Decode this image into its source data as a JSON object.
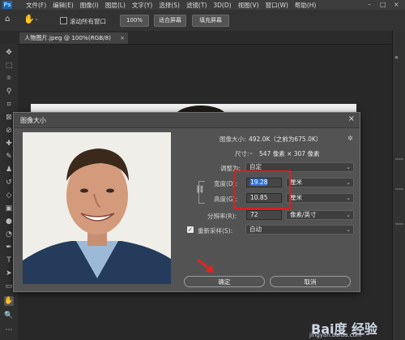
{
  "app": {
    "logo": "Ps"
  },
  "menu": [
    "文件(F)",
    "编辑(E)",
    "图像(I)",
    "图层(L)",
    "文字(Y)",
    "选择(S)",
    "滤镜(T)",
    "3D(D)",
    "视图(V)",
    "窗口(W)",
    "帮助(H)"
  ],
  "options": {
    "scroll_all": "滚动所有窗口",
    "zoom": "100%",
    "fit_screen": "适合屏幕",
    "fill_screen": "填充屏幕"
  },
  "document_tab": {
    "label": "人物图片.jpeg @ 100%(RGB/8)",
    "close": "×"
  },
  "dialog": {
    "title": "图像大小",
    "image_size_label": "图像大小:",
    "image_size_value": "492.0K（之前为675.0K）",
    "dimensions_label": "尺寸:",
    "dimensions_value": "547 像素 × 307 像素",
    "fit_to_label": "调整为:",
    "fit_to_value": "自定",
    "width_label": "宽度(D):",
    "width_value": "19.28",
    "width_unit": "厘米",
    "height_label": "高度(G):",
    "height_value": "10.85",
    "height_unit": "厘米",
    "resolution_label": "分辨率(R):",
    "resolution_value": "72",
    "resolution_unit": "像素/英寸",
    "resample_label": "重新采样(S):",
    "resample_value": "自动",
    "resample_checked": true,
    "ok": "确定",
    "cancel": "取消"
  },
  "watermark": {
    "logo": "Bai度 经验",
    "url": "jingyan.baidu.com"
  },
  "colors": {
    "highlight": "#d62020",
    "accent": "#1a66b3",
    "arrow": "#e0241e"
  }
}
